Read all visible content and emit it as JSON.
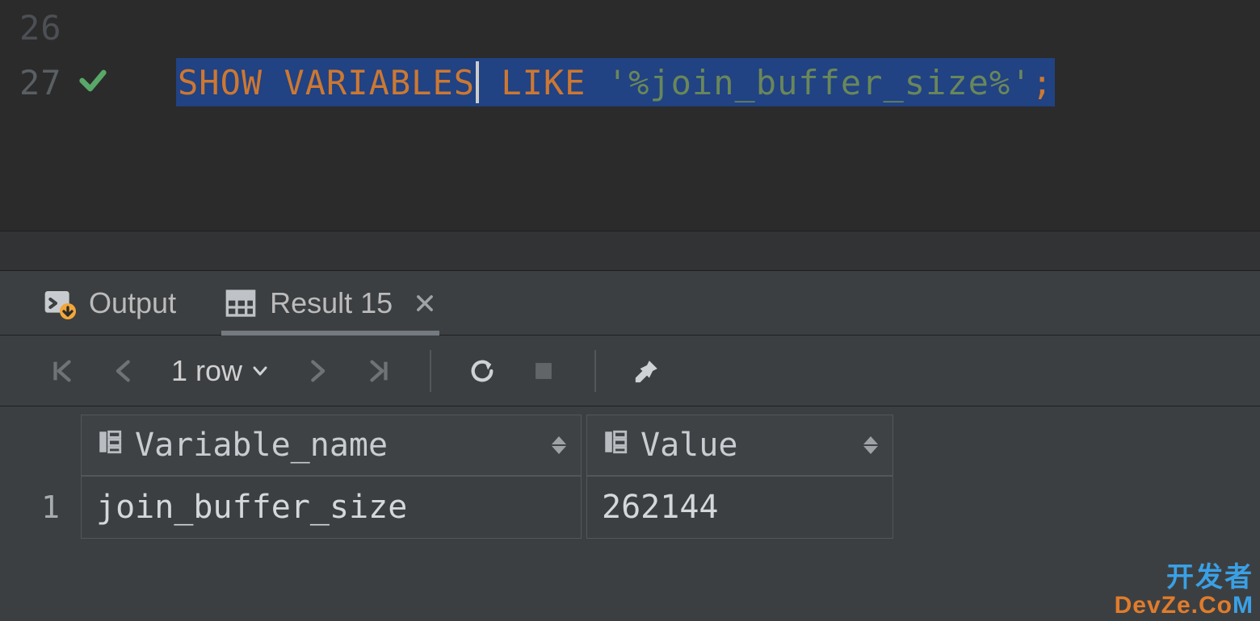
{
  "editor": {
    "prev_line_number": "26",
    "line_number": "27",
    "tokens": {
      "kw1": "SHOW",
      "kw2": "VARIABLES",
      "kw3": "LIKE",
      "str": "'%join_buffer_size%'",
      "semi": ";"
    }
  },
  "tabs": {
    "output_label": "Output",
    "result_label": "Result 15"
  },
  "toolbar": {
    "row_count_label": "1 row"
  },
  "table": {
    "columns": {
      "c1": "Variable_name",
      "c2": "Value"
    },
    "rows": [
      {
        "idx": "1",
        "variable_name": "join_buffer_size",
        "value": "262144"
      }
    ]
  },
  "watermark": {
    "line1": "开发者",
    "line2a": "DevZe.Co",
    "line2b": "M"
  }
}
